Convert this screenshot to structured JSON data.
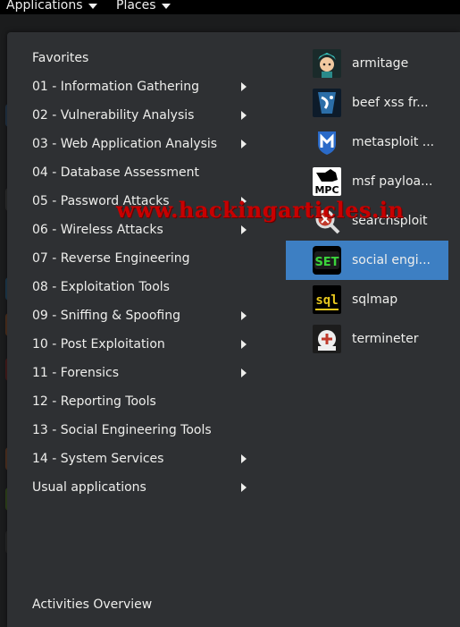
{
  "topbar": {
    "applications_label": "Applications",
    "places_label": "Places"
  },
  "categories": [
    {
      "label": "Favorites",
      "submenu": false
    },
    {
      "label": "01 - Information Gathering",
      "submenu": true
    },
    {
      "label": "02 - Vulnerability Analysis",
      "submenu": true
    },
    {
      "label": "03 - Web Application Analysis",
      "submenu": true
    },
    {
      "label": "04 - Database Assessment",
      "submenu": false
    },
    {
      "label": "05 - Password Attacks",
      "submenu": true
    },
    {
      "label": "06 - Wireless Attacks",
      "submenu": true
    },
    {
      "label": "07 - Reverse Engineering",
      "submenu": false
    },
    {
      "label": "08 - Exploitation Tools",
      "submenu": false
    },
    {
      "label": "09 - Sniffing & Spoofing",
      "submenu": true
    },
    {
      "label": "10 - Post Exploitation",
      "submenu": true
    },
    {
      "label": "11 - Forensics",
      "submenu": true
    },
    {
      "label": "12 - Reporting Tools",
      "submenu": false
    },
    {
      "label": "13 - Social Engineering Tools",
      "submenu": false
    },
    {
      "label": "14 - System Services",
      "submenu": true
    },
    {
      "label": "Usual applications",
      "submenu": true
    }
  ],
  "apps": [
    {
      "label": "armitage",
      "icon": "armitage-icon",
      "selected": false
    },
    {
      "label": "beef xss fr...",
      "icon": "beef-icon",
      "selected": false
    },
    {
      "label": "metasploit ...",
      "icon": "metasploit-icon",
      "selected": false
    },
    {
      "label": "msf payloa...",
      "icon": "msfpc-icon",
      "selected": false
    },
    {
      "label": "searchsploit",
      "icon": "searchsploit-icon",
      "selected": false
    },
    {
      "label": "social engi...",
      "icon": "set-icon",
      "selected": true
    },
    {
      "label": "sqlmap",
      "icon": "sqlmap-icon",
      "selected": false
    },
    {
      "label": "termineter",
      "icon": "termineter-icon",
      "selected": false
    }
  ],
  "icon_text": {
    "msfpc": "MPC",
    "set": "SET",
    "sqlmap": "sql"
  },
  "activities_label": "Activities Overview",
  "watermark": "www.hackingarticles.in",
  "colors": {
    "menu_bg": "#2e3033",
    "selected": "#3d7fc3",
    "watermark": "#c80000"
  }
}
